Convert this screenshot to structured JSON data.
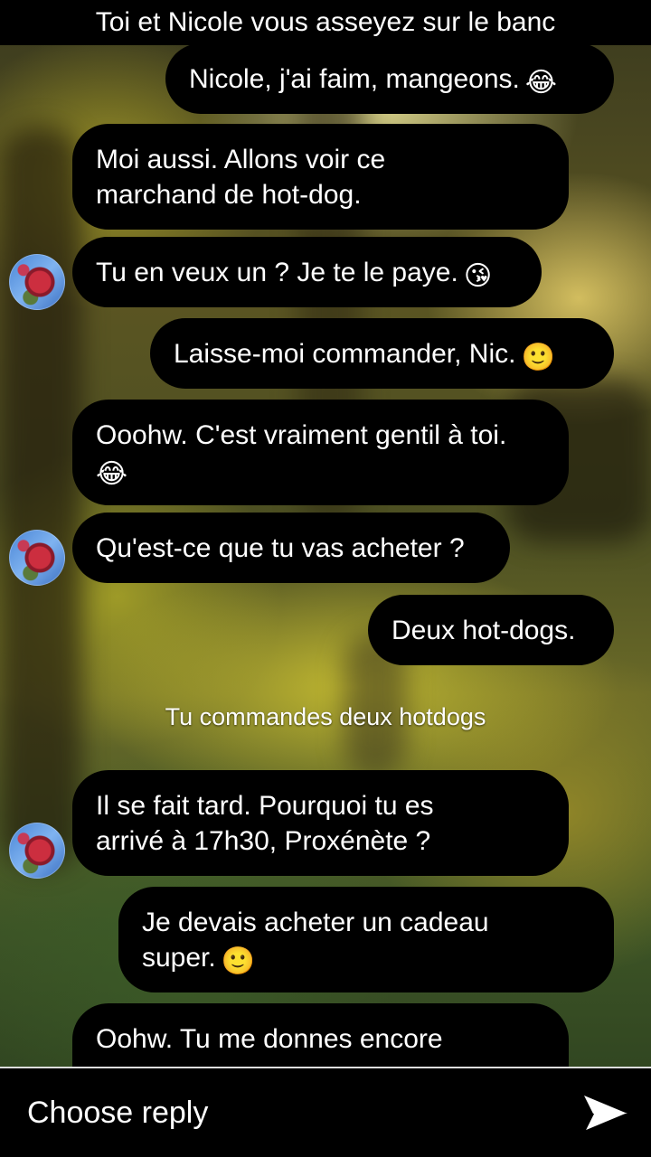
{
  "header": {
    "title": "Toi et Nicole vous asseyez sur le banc"
  },
  "messages": [
    {
      "side": "right",
      "text": "Nicole, j'ai faim, mangeons.",
      "emoji": "😂",
      "emoji_name": "laughing-tears-emoji"
    },
    {
      "side": "left",
      "text": "Moi aussi. Allons voir ce\nmarchand de hot-dog.",
      "emoji": "",
      "emoji_name": ""
    },
    {
      "side": "left",
      "text": "Tu en veux un ? Je te le paye.",
      "emoji": "😘",
      "emoji_name": "wink-kiss-emoji"
    },
    {
      "side": "right",
      "text": "Laisse-moi commander, Nic.",
      "emoji": "🙂",
      "emoji_name": "smile-emoji"
    },
    {
      "side": "left",
      "text": "Ooohw. C'est vraiment gentil à toi.",
      "emoji": "😂",
      "emoji_name": "laughing-tears-emoji"
    },
    {
      "side": "left",
      "text": "Qu'est-ce que tu vas acheter ?",
      "emoji": "",
      "emoji_name": ""
    },
    {
      "side": "right",
      "text": "Deux hot-dogs.",
      "emoji": "",
      "emoji_name": ""
    },
    {
      "side": "left",
      "text": "Il se fait tard. Pourquoi tu es\narrivé à 17h30, Proxénète ?",
      "emoji": "",
      "emoji_name": ""
    },
    {
      "side": "right",
      "text": "Je devais acheter un cadeau\nsuper.",
      "emoji": "🙂",
      "emoji_name": "smile-emoji"
    },
    {
      "side": "left",
      "text": "Oohw. Tu me donnes encore",
      "emoji": "",
      "emoji_name": ""
    }
  ],
  "narration": "Tu commandes deux hotdogs",
  "reply": {
    "label": "Choose reply",
    "send_icon": "send-arrow-icon"
  },
  "colors": {
    "bubble": "#000000",
    "text": "#ffffff"
  }
}
